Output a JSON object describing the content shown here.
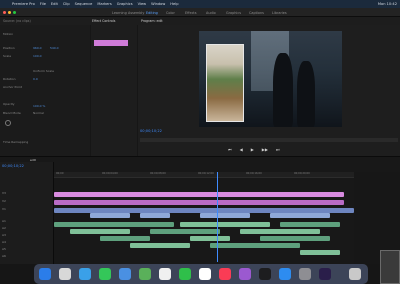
{
  "menubar": {
    "items": [
      "Premiere Pro",
      "File",
      "Edit",
      "Clip",
      "Sequence",
      "Markers",
      "Graphics",
      "View",
      "Window",
      "Help"
    ],
    "right": "Mon 10:42"
  },
  "workspaces": {
    "items": [
      "Learning",
      "Assembly",
      "Editing",
      "Color",
      "Effects",
      "Audio",
      "Graphics",
      "Captions",
      "Libraries"
    ],
    "active_index": 2
  },
  "panels": {
    "left_tab": "Source: (no clips)",
    "center_tab": "Effect Controls",
    "program_tab": "Program: edit"
  },
  "effect_controls": {
    "rows": [
      "Motion",
      "Position",
      "Scale",
      "Uniform Scale",
      "Rotation",
      "Anchor Point",
      "Opacity",
      "Blend Mode",
      "Time Remapping"
    ],
    "values": [
      "960.0",
      "540.0",
      "100.0",
      "0.0",
      "100.0 %",
      "Normal"
    ]
  },
  "program": {
    "timecode": "00;00;10;22",
    "transport": [
      "⏮",
      "◀",
      "▶",
      "▶▶",
      "⏭"
    ]
  },
  "timeline": {
    "tab": "edit",
    "playhead_timecode": "00;00;10;22",
    "ruler": [
      "00;00",
      "00;00;04;00",
      "00;00;08;00",
      "00;00;12;00",
      "00;00;16;00",
      "00;00;20;00",
      "00;00;24;00"
    ],
    "tracks": [
      "V3",
      "V2",
      "V1",
      "A1",
      "A2",
      "A3",
      "A4",
      "A5",
      "A6"
    ]
  },
  "dock": {
    "icons": [
      "finder-icon",
      "launchpad-icon",
      "safari-icon",
      "messages-icon",
      "mail-icon",
      "maps-icon",
      "photos-icon",
      "facetime-icon",
      "calendar-icon",
      "music-icon",
      "podcasts-icon",
      "tv-icon",
      "appstore-icon",
      "settings-icon",
      "premiere-icon",
      "trash-icon"
    ],
    "colors": [
      "#2b7de9",
      "#d8d8d8",
      "#3aa0e8",
      "#34c759",
      "#4a90e2",
      "#5ab05a",
      "#f0f0f0",
      "#2fbf4a",
      "#ffffff",
      "#fa3c55",
      "#9b59d0",
      "#1d1d1f",
      "#2d8cf0",
      "#8e8e93",
      "#2a1e4a",
      "#c9c9c9"
    ]
  }
}
